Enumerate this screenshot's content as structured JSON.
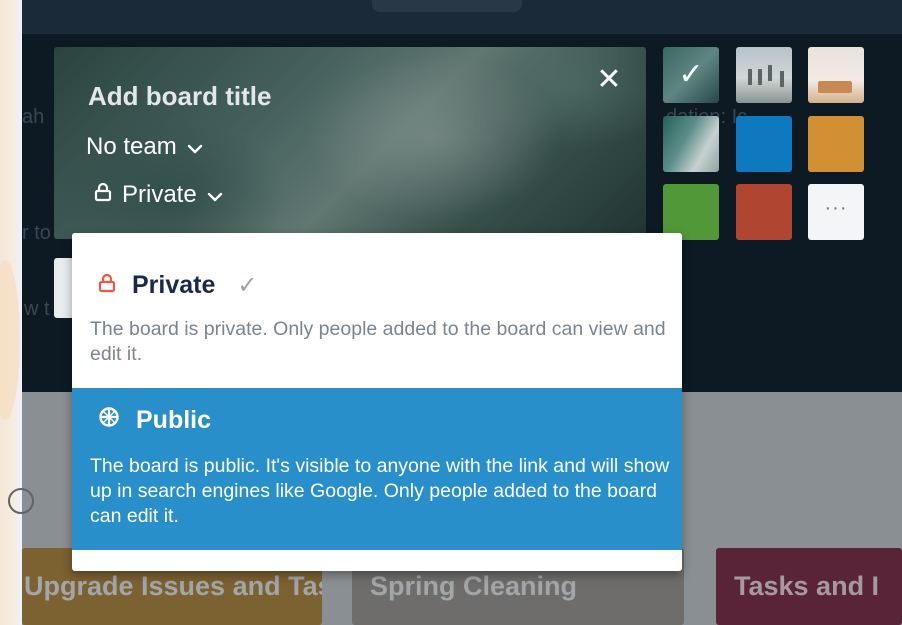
{
  "background": {
    "cards": [
      {
        "label": "Upgrade Issues and Tasks",
        "color": "#7c6131"
      },
      {
        "label": "Spring Cleaning",
        "color": "#6e6d6b"
      },
      {
        "label": "Tasks and I",
        "color": "#5a2438"
      }
    ]
  },
  "create_board": {
    "title_placeholder": "Add board title",
    "team_label": "No team",
    "visibility_label": "Private",
    "close_symbol": "✕"
  },
  "swatches": {
    "selected_check": "✓",
    "more_label": "···",
    "colors": [
      "#0f79bf",
      "#d29034",
      "#519839",
      "#b04632"
    ]
  },
  "visibility_menu": {
    "private": {
      "label": "Private",
      "check": "✓",
      "description": "The board is private. Only people added to the board can view and edit it."
    },
    "public": {
      "label": "Public",
      "description": "The board is public. It's visible to anyone with the link and will show up in search engines like Google. Only people added to the board can edit it."
    }
  }
}
